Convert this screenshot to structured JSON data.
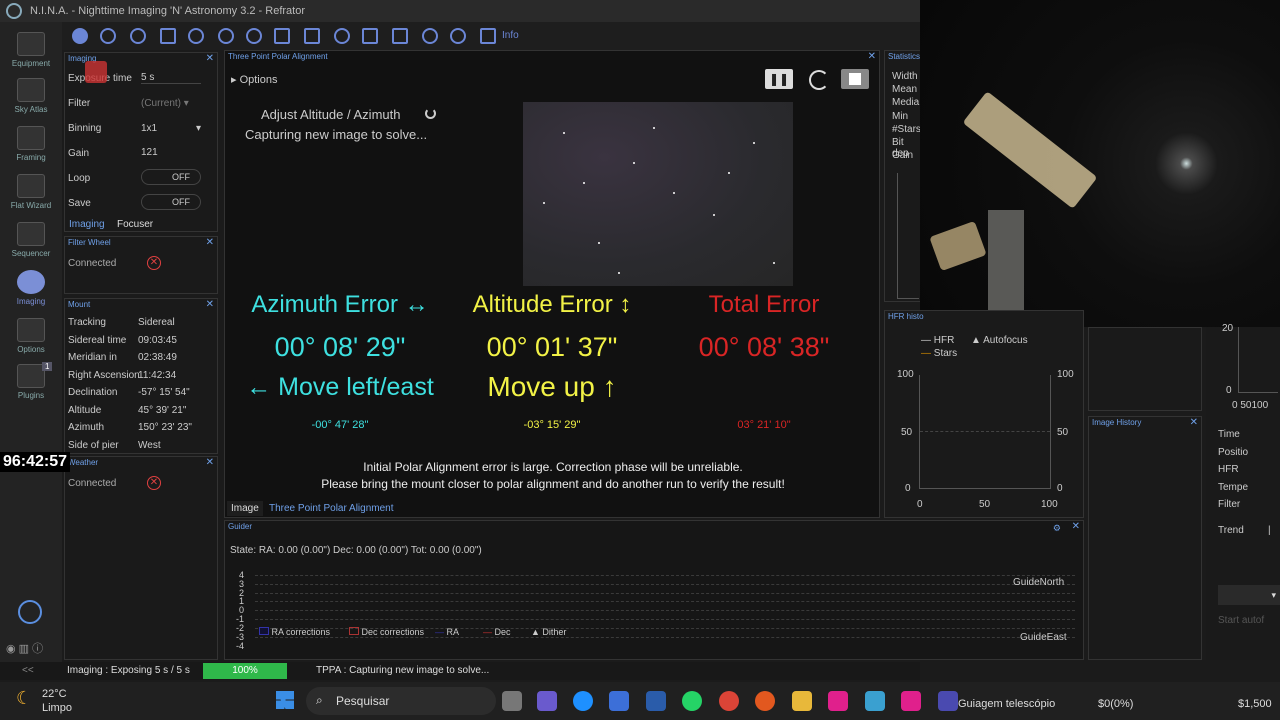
{
  "window": {
    "title": "N.I.N.A. - Nighttime Imaging 'N' Astronomy 3.2  -  Refrator"
  },
  "sidebar": [
    {
      "label": "Equipment"
    },
    {
      "label": "Sky Atlas"
    },
    {
      "label": "Framing"
    },
    {
      "label": "Flat Wizard"
    },
    {
      "label": "Sequencer"
    },
    {
      "label": "Imaging"
    },
    {
      "label": "Options"
    },
    {
      "label": "Plugins",
      "badge": "1"
    }
  ],
  "toolbar": {
    "info": "Info"
  },
  "imaging_panel": {
    "title": "Imaging",
    "exposure_label": "Exposure time",
    "exposure": "5",
    "exposure_unit": "s",
    "filter_label": "Filter",
    "filter": "(Current)",
    "binning_label": "Binning",
    "binning": "1x1",
    "gain_label": "Gain",
    "gain": "121",
    "loop_label": "Loop",
    "loop": "OFF",
    "save_label": "Save",
    "save": "OFF",
    "tab_imaging": "Imaging",
    "tab_focuser": "Focuser"
  },
  "filter_wheel": {
    "title": "Filter Wheel",
    "status": "Connected"
  },
  "mount": {
    "title": "Mount",
    "rows": [
      {
        "k": "Tracking",
        "v": "Sidereal"
      },
      {
        "k": "Sidereal time",
        "v": "09:03:45"
      },
      {
        "k": "Meridian in",
        "v": "02:38:49"
      },
      {
        "k": "Right Ascension",
        "v": "11:42:34"
      },
      {
        "k": "Declination",
        "v": "-57° 15' 54\""
      },
      {
        "k": "Altitude",
        "v": "45° 39' 21\""
      },
      {
        "k": "Azimuth",
        "v": "150° 23' 23\""
      },
      {
        "k": "Side of pier",
        "v": "West"
      }
    ]
  },
  "weather": {
    "title": "Weather",
    "status": "Connected"
  },
  "overlay_timer": "96:42:57",
  "tppa": {
    "title": "Three Point Polar Alignment",
    "options": "Options",
    "step": "Adjust Altitude / Azimuth",
    "step_status": "Capturing new image to solve...",
    "az_title": "Azimuth Error ↔",
    "az_value": "00° 08' 29\"",
    "az_move": "← Move left/east",
    "az_detail": "-00° 47' 28\"",
    "alt_title": "Altitude Error ↕",
    "alt_value": "00° 01' 37\"",
    "alt_move": "Move up ↑",
    "alt_detail": "-03° 15' 29\"",
    "tot_title": "Total Error",
    "tot_value": "00° 08' 38\"",
    "tot_detail": "03° 21' 10\"",
    "warn1": "Initial Polar Alignment error is large. Correction phase will be unreliable.",
    "warn2": "Please bring the mount closer to polar alignment and do another run to verify the result!",
    "tab_image": "Image",
    "tab_tppa": "Three Point Polar Alignment"
  },
  "statistics": {
    "title": "Statistics",
    "rows": [
      "Width",
      "Mean",
      "Media",
      "Min",
      "#Stars",
      "Bit dep",
      "Gain"
    ]
  },
  "hfr_history": {
    "title": "HFR histo",
    "legend_hfr": "HFR",
    "legend_af": "Autofocus",
    "legend_stars": "Stars",
    "y_ticks": [
      "100",
      "50",
      "0"
    ],
    "y_ticks_right": [
      "100",
      "50",
      "0"
    ],
    "x_ticks": [
      "0",
      "50",
      "100"
    ]
  },
  "image_history": {
    "title": "Image History"
  },
  "right_col": {
    "top_tick": "20",
    "zero": "0",
    "x_label": "0 50100",
    "rows": [
      "Time",
      "Positio",
      "HFR",
      "Tempe",
      "Filter"
    ],
    "trend": "Trend",
    "trend_val": "|",
    "start": "Start autof"
  },
  "guider": {
    "title": "Guider",
    "state": "State:  RA: 0.00 (0.00\")  Dec: 0.00 (0.00\")  Tot: 0.00 (0.00\")",
    "y_ticks": [
      "4",
      "3",
      "2",
      "1",
      "0",
      "-1",
      "-2",
      "-3",
      "-4"
    ],
    "north": "GuideNorth",
    "east": "GuideEast",
    "legend": [
      "RA corrections",
      "Dec corrections",
      "RA",
      "Dec",
      "Dither"
    ]
  },
  "status": {
    "collapse": "<<",
    "imaging": "Imaging :   Exposing 5 s / 5 s",
    "progress": "100%",
    "progress_value": 1.0,
    "tppa": "TPPA :   Capturing new image to solve..."
  },
  "taskbar": {
    "temp": "22°C",
    "weather": "Limpo",
    "search": "Pesquisar",
    "app": "Guiagem telescópio",
    "balance": "$0(0%)",
    "right": "$1,500"
  }
}
